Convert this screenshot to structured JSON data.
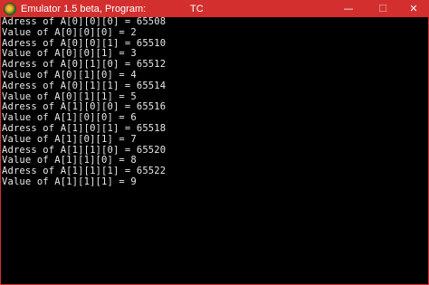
{
  "window": {
    "title": "Emulator 1.5 beta, Program:",
    "program": "TC",
    "buttons": {
      "minimize": "—",
      "maximize": "☐",
      "close": "✕"
    },
    "colors": {
      "titlebar": "#d32f2f",
      "console_background": "#000000",
      "console_text": "#e8e8e8"
    }
  },
  "console": {
    "lines": [
      "Adress of A[0][0][0] = 65508",
      "Value of A[0][0][0] = 2",
      "Adress of A[0][0][1] = 65510",
      "Value of A[0][0][1] = 3",
      "Adress of A[0][1][0] = 65512",
      "Value of A[0][1][0] = 4",
      "Adress of A[0][1][1] = 65514",
      "Value of A[0][1][1] = 5",
      "Adress of A[1][0][0] = 65516",
      "Value of A[1][0][0] = 6",
      "Adress of A[1][0][1] = 65518",
      "Value of A[1][0][1] = 7",
      "Adress of A[1][1][0] = 65520",
      "Value of A[1][1][0] = 8",
      "Adress of A[1][1][1] = 65522",
      "Value of A[1][1][1] = 9"
    ]
  }
}
